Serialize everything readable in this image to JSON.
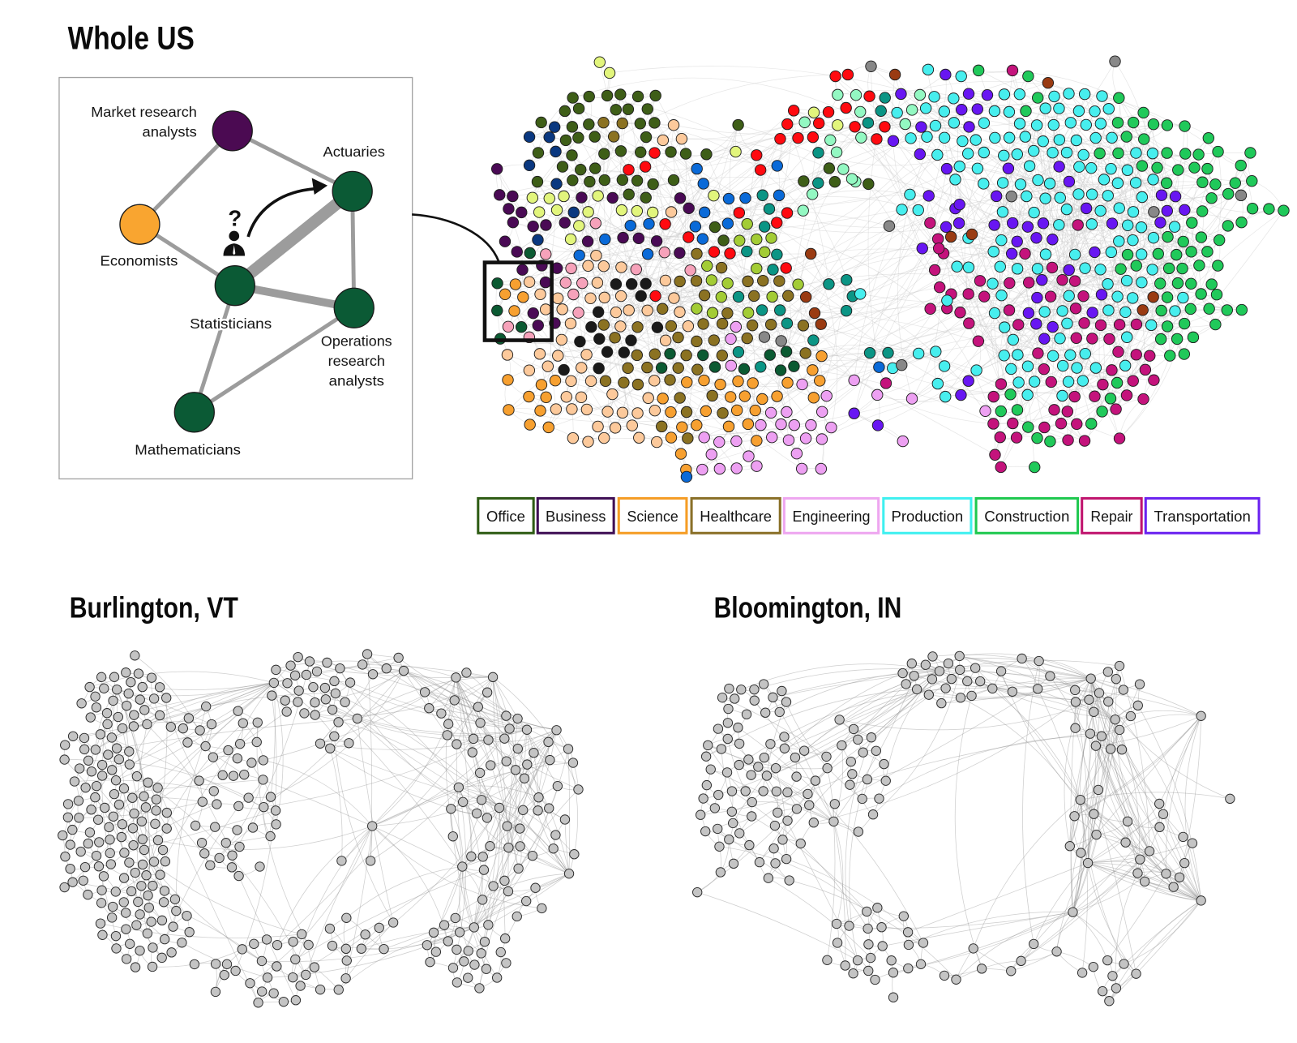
{
  "titles": {
    "whole_us": "Whole US",
    "burlington": "Burlington, VT",
    "bloomington": "Bloomington, IN"
  },
  "inset": {
    "question_mark": "?",
    "icons": {
      "person": "person-icon",
      "arrow": "curved-arrow-icon"
    },
    "edge_color": "#9c9c9c",
    "nodes": {
      "market_research": {
        "label": [
          "Market research",
          "analysts"
        ],
        "color": "#4b0a52"
      },
      "actuaries": {
        "label": [
          "Actuaries"
        ],
        "color": "#0b5a35"
      },
      "economists": {
        "label": [
          "Economists"
        ],
        "color": "#f9a530"
      },
      "statisticians": {
        "label": [
          "Statisticians"
        ],
        "color": "#0b5a35"
      },
      "operations_research": {
        "label": [
          "Operations",
          "research",
          "analysts"
        ],
        "color": "#0b5a35"
      },
      "mathematicians": {
        "label": [
          "Mathematicians"
        ],
        "color": "#0b5a35"
      }
    },
    "edges": [
      {
        "source": "market_research",
        "target": "economists",
        "weight": 1
      },
      {
        "source": "market_research",
        "target": "actuaries",
        "weight": 1
      },
      {
        "source": "economists",
        "target": "statisticians",
        "weight": 1
      },
      {
        "source": "statisticians",
        "target": "actuaries",
        "weight": 3
      },
      {
        "source": "statisticians",
        "target": "operations_research",
        "weight": 2
      },
      {
        "source": "actuaries",
        "target": "operations_research",
        "weight": 1
      },
      {
        "source": "statisticians",
        "target": "mathematicians",
        "weight": 1
      },
      {
        "source": "operations_research",
        "target": "mathematicians",
        "weight": 1
      }
    ]
  },
  "legend": [
    {
      "label": "Office",
      "color": "#2e5c14"
    },
    {
      "label": "Business",
      "color": "#3f0f55"
    },
    {
      "label": "Science",
      "color": "#f59d25"
    },
    {
      "label": "Healthcare",
      "color": "#8a7028"
    },
    {
      "label": "Engineering",
      "color": "#eea6f0"
    },
    {
      "label": "Production",
      "color": "#3ff0f0"
    },
    {
      "label": "Construction",
      "color": "#1fc84f"
    },
    {
      "label": "Repair",
      "color": "#c0146e"
    },
    {
      "label": "Transportation",
      "color": "#6a22f0"
    }
  ],
  "node_palette": {
    "O": "#3e5e17",
    "N": "#0a3880",
    "P": "#4a0a55",
    "Y": "#e2f57c",
    "B": "#0a6ad8",
    "K": "#f6a2ba",
    "E": "#fcc99b",
    "S": "#f7a030",
    "H": "#8b7222",
    "X": "#1a1a1a",
    "G": "#0b5a32",
    "T": "#0b9585",
    "L": "#a3cc35",
    "R": "#ff0a10",
    "M": "#93f8c2",
    "W": "#eda0f2",
    "C": "#47eeee",
    "Q": "#20c95a",
    "J": "#c4137c",
    "V": "#6816f2",
    "A": "#888888",
    "U": "#9a3b12"
  },
  "city_networks": {
    "node_color": "#c4c4c4",
    "edge_color": "#8c8c8c"
  }
}
